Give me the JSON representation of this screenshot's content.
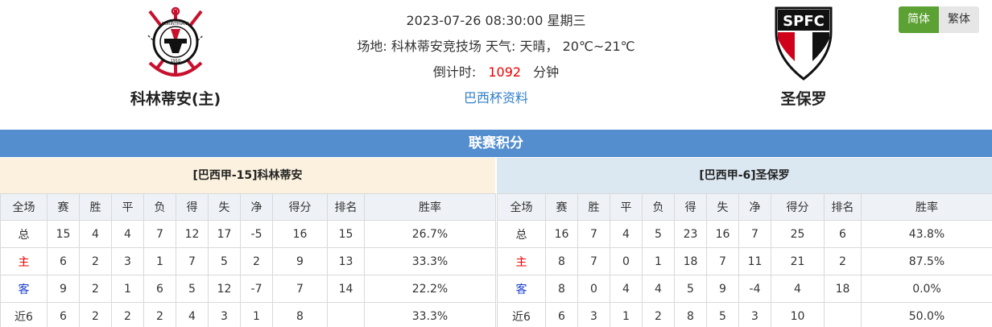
{
  "match": {
    "datetime": "2023-07-26 08:30:00 星期三",
    "venue_label": "场地:",
    "venue": "科林蒂安竞技场",
    "weather_label": "天气:",
    "weather": "天晴，",
    "temperature": "20℃~21℃",
    "countdown_label": "倒计时:",
    "countdown_value": "1092",
    "countdown_unit": "分钟",
    "competition_link": "巴西杯资料"
  },
  "home_team": {
    "name": "科林蒂安(主)",
    "logo_text": "CORINTHIANS",
    "logo_year": "1910",
    "logo_icon": "corinthians-crest-icon"
  },
  "away_team": {
    "name": "圣保罗",
    "logo_text": "SPFC",
    "logo_icon": "spfc-crest-icon"
  },
  "language": {
    "simplified": "简体",
    "traditional": "繁体",
    "active_color": "#5ba133"
  },
  "standings": {
    "title": "联赛积分",
    "columns": [
      "全场",
      "赛",
      "胜",
      "平",
      "负",
      "得",
      "失",
      "净",
      "得分",
      "排名",
      "胜率"
    ],
    "home": {
      "title": "[巴西甲-15]科林蒂安",
      "rows": [
        [
          "总",
          "15",
          "4",
          "4",
          "7",
          "12",
          "17",
          "-5",
          "16",
          "15",
          "26.7%"
        ],
        [
          "主",
          "6",
          "2",
          "3",
          "1",
          "7",
          "5",
          "2",
          "9",
          "13",
          "33.3%"
        ],
        [
          "客",
          "9",
          "2",
          "1",
          "6",
          "5",
          "12",
          "-7",
          "7",
          "14",
          "22.2%"
        ],
        [
          "近6",
          "6",
          "2",
          "2",
          "2",
          "4",
          "3",
          "1",
          "8",
          "",
          "33.3%"
        ]
      ]
    },
    "away": {
      "title": "[巴西甲-6]圣保罗",
      "rows": [
        [
          "总",
          "16",
          "7",
          "4",
          "5",
          "23",
          "16",
          "7",
          "25",
          "6",
          "43.8%"
        ],
        [
          "主",
          "8",
          "7",
          "0",
          "1",
          "18",
          "7",
          "11",
          "21",
          "2",
          "87.5%"
        ],
        [
          "客",
          "8",
          "0",
          "4",
          "4",
          "5",
          "9",
          "-4",
          "4",
          "18",
          "0.0%"
        ],
        [
          "近6",
          "6",
          "3",
          "1",
          "2",
          "8",
          "5",
          "3",
          "10",
          "",
          "50.0%"
        ]
      ]
    }
  }
}
